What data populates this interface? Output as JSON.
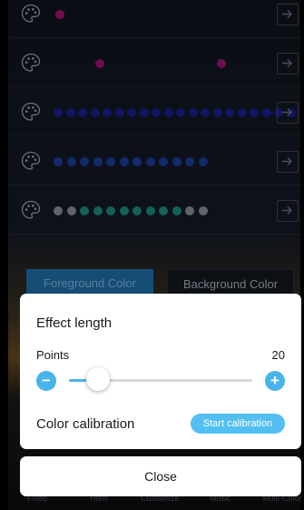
{
  "effect_rows": [
    {
      "dots": [
        {
          "color": "#a3146f"
        }
      ]
    },
    {
      "dots": [
        {
          "color": "#a3146f"
        },
        {
          "color": "#a3146f"
        }
      ]
    },
    {
      "dots": [
        {
          "color": "#1a1f8c"
        },
        {
          "color": "#1a1f8c"
        },
        {
          "color": "#1a1f8c"
        },
        {
          "color": "#1a1f8c"
        },
        {
          "color": "#1a1f8c"
        },
        {
          "color": "#1a1f8c"
        },
        {
          "color": "#1a1f8c"
        },
        {
          "color": "#1a1f8c"
        },
        {
          "color": "#1a1f8c"
        },
        {
          "color": "#1a1f8c"
        },
        {
          "color": "#1a1f8c"
        },
        {
          "color": "#1a1f8c"
        },
        {
          "color": "#1a1f8c"
        },
        {
          "color": "#1a1f8c"
        },
        {
          "color": "#1a1f8c"
        },
        {
          "color": "#1a1f8c"
        },
        {
          "color": "#1a1f8c"
        },
        {
          "color": "#1a1f8c"
        },
        {
          "color": "#1a1f8c"
        },
        {
          "color": "#1a1f8c"
        }
      ]
    },
    {
      "dots": [
        {
          "color": "#1a3e9e"
        },
        {
          "color": "#1a3e9e"
        },
        {
          "color": "#1a3e9e"
        },
        {
          "color": "#1a3e9e"
        },
        {
          "color": "#1a3e9e"
        },
        {
          "color": "#1a3e9e"
        },
        {
          "color": "#1a3e9e"
        },
        {
          "color": "#1a3e9e"
        },
        {
          "color": "#1a3e9e"
        },
        {
          "color": "#1a3e9e"
        },
        {
          "color": "#1a3e9e"
        },
        {
          "color": "#1a3e9e"
        }
      ]
    },
    {
      "dots": [
        {
          "color": "#8a8f98"
        },
        {
          "color": "#8a8f98"
        },
        {
          "color": "#1f8b7e"
        },
        {
          "color": "#1f8b7e"
        },
        {
          "color": "#1f8b7e"
        },
        {
          "color": "#1f8b7e"
        },
        {
          "color": "#1f8b7e"
        },
        {
          "color": "#1f8b7e"
        },
        {
          "color": "#1f8b7e"
        },
        {
          "color": "#1f8b7e"
        },
        {
          "color": "#8a8f98"
        },
        {
          "color": "#8a8f98"
        }
      ]
    }
  ],
  "color_tabs": {
    "foreground_label": "Foreground Color",
    "background_label": "Background Color"
  },
  "bottom_tabs": [
    "Fixed",
    "Horn",
    "Customize",
    "Music",
    "Multi-Color"
  ],
  "effect_sheet": {
    "title": "Effect length",
    "points_label": "Points",
    "points_value": "20",
    "slider_level": 0.16,
    "minus_glyph": "−",
    "plus_glyph": "+",
    "calibration_label": "Color calibration",
    "calibration_button": "Start calibration"
  },
  "close_label": "Close",
  "colors": {
    "accent": "#49b4eb",
    "calibration_button": "#52bff0",
    "foreground_tab": "#1f6fa8"
  }
}
